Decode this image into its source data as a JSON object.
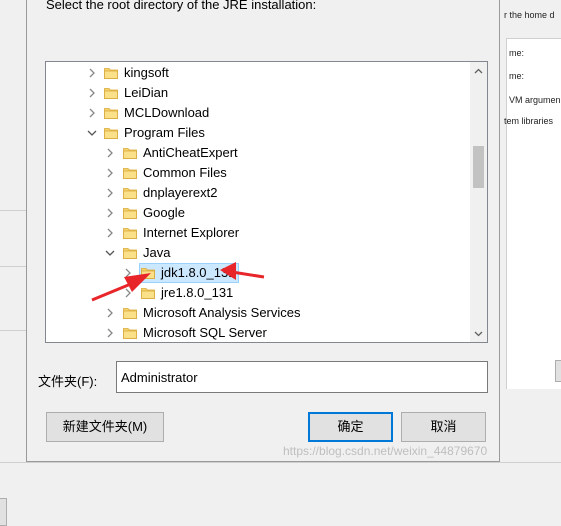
{
  "dialog": {
    "prompt": "Select the root directory of the JRE installation:",
    "folder_label": "文件夹(F):",
    "folder_value": "Administrator",
    "new_folder_button": "新建文件夹(M)",
    "ok_button": "确定",
    "cancel_button": "取消"
  },
  "tree": {
    "items": [
      {
        "label": "kingsoft",
        "level": 1,
        "expanded": false
      },
      {
        "label": "LeiDian",
        "level": 1,
        "expanded": false
      },
      {
        "label": "MCLDownload",
        "level": 1,
        "expanded": false
      },
      {
        "label": "Program Files",
        "level": 1,
        "expanded": true
      },
      {
        "label": "AntiCheatExpert",
        "level": 2,
        "expanded": false
      },
      {
        "label": "Common Files",
        "level": 2,
        "expanded": false
      },
      {
        "label": "dnplayerext2",
        "level": 2,
        "expanded": false
      },
      {
        "label": "Google",
        "level": 2,
        "expanded": false
      },
      {
        "label": "Internet Explorer",
        "level": 2,
        "expanded": false
      },
      {
        "label": "Java",
        "level": 2,
        "expanded": true
      },
      {
        "label": "jdk1.8.0_131",
        "level": 3,
        "expanded": false,
        "selected": true
      },
      {
        "label": "jre1.8.0_131",
        "level": 3,
        "expanded": false
      },
      {
        "label": "Microsoft Analysis Services",
        "level": 2,
        "expanded": false
      },
      {
        "label": "Microsoft SQL Server",
        "level": 2,
        "expanded": false
      }
    ]
  },
  "background_window": {
    "text1": "r the home d",
    "text2": "me:",
    "text3": "me:",
    "text4": "VM argumen",
    "text5": "tem libraries"
  },
  "watermark": "https://blog.csdn.net/weixin_44879670",
  "colors": {
    "folder": "#f6d26b",
    "selection": "#cce8ff",
    "annotation_arrow": "#e8262a",
    "default_button_border": "#0078d7"
  }
}
